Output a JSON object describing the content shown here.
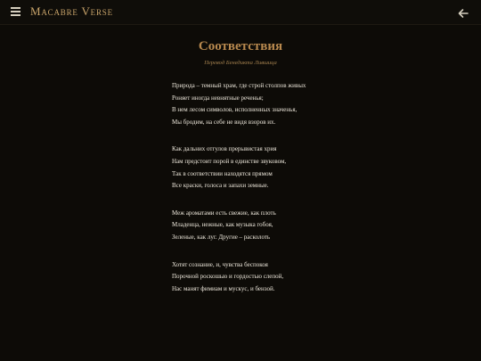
{
  "header": {
    "brand": "Macabre Verse",
    "menu_icon": "hamburger-menu-icon",
    "back_icon": "arrow-left-icon",
    "accent_color": "#c9a46a"
  },
  "poem": {
    "title": "Соответствия",
    "translator": "Перевод Бенедикта Лившица",
    "stanzas": [
      {
        "lines": [
          "Природа – темный храм, где строй столпов живых",
          "Роняет иногда невнятные реченья;",
          "В нем лесом символов, исполненных значенья,",
          "Мы бродим, на себе не видя взоров их."
        ]
      },
      {
        "lines": [
          "Как дальних отгулов прерывистая хрия",
          "Нам предстоит порой в единстве звуковом,",
          "Так в соответствии находятся прямом",
          "Все краски, голоса и запахи земные."
        ]
      },
      {
        "lines": [
          "Меж ароматами есть свежие, как плоть",
          "Младенца, нежные, как музыка гобоя,",
          "Зеленые, как луг. Другие – расколоть"
        ]
      },
      {
        "lines": [
          "Хотят сознание, и, чувства беспокоя",
          "Порочной роскошью и гордостью слепой,",
          "Нас манят фимиам и мускус, и бензой."
        ]
      }
    ]
  }
}
